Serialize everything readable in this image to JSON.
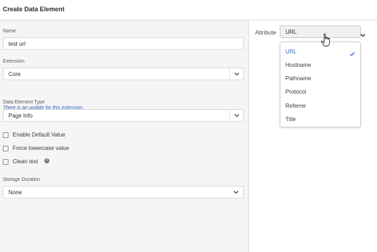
{
  "header": {
    "title": "Create Data Element"
  },
  "form": {
    "name": {
      "label": "Name",
      "value": "test url"
    },
    "extension": {
      "label": "Extension",
      "value": "Core",
      "update_note": "There is an update for ",
      "update_link": "this extension."
    },
    "data_element_type": {
      "label": "Data Element Type",
      "value": "Page Info"
    },
    "checkboxes": {
      "enable_default": {
        "label": "Enable Default Value",
        "checked": false
      },
      "force_lowercase": {
        "label": "Force lowercase value",
        "checked": false
      },
      "clean_text": {
        "label": "Clean text",
        "checked": false
      }
    },
    "storage_duration": {
      "label": "Storage Duration",
      "value": "None"
    }
  },
  "attribute": {
    "label": "Attribute",
    "value": "URL",
    "options": [
      "URL",
      "Hostname",
      "Pathname",
      "Protocol",
      "Referrer",
      "Title"
    ],
    "selected": "URL"
  },
  "icons": {
    "chevron": "chevron-down-icon",
    "info": "info-icon",
    "check": "checkmark-icon",
    "cursor": "hand-pointer-icon"
  },
  "colors": {
    "accent": "#2d6fd7",
    "link": "#2d6fd7"
  }
}
